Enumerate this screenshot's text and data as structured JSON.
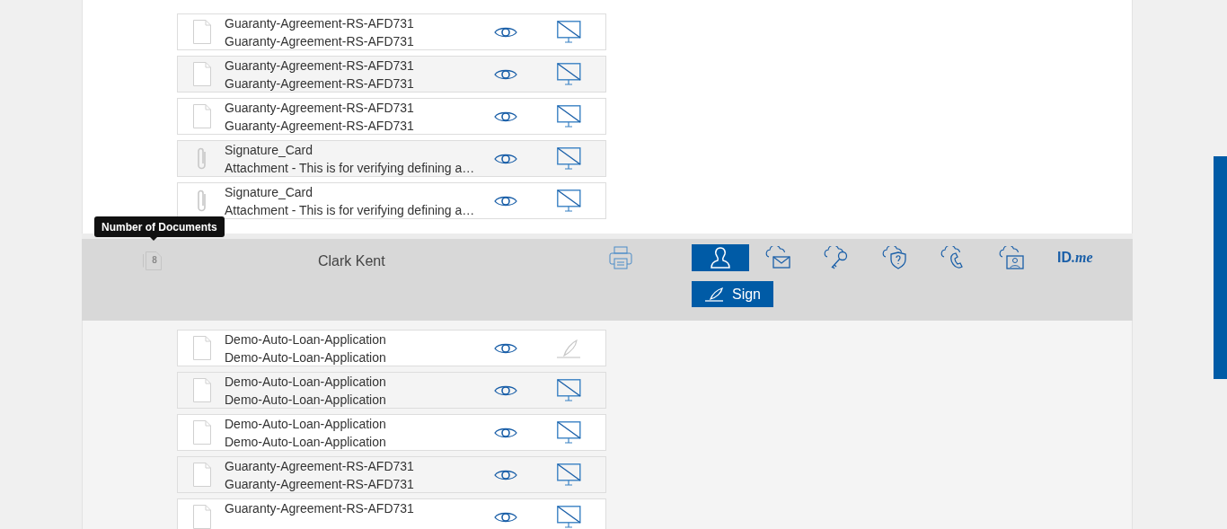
{
  "top_documents": [
    {
      "kind": "document",
      "title": "Guaranty-Agreement-RS-AFD731",
      "subtitle": "Guaranty-Agreement-RS-AFD731",
      "action": {
        "kind": "monitor"
      }
    },
    {
      "kind": "document",
      "title": "Guaranty-Agreement-RS-AFD731",
      "subtitle": "Guaranty-Agreement-RS-AFD731",
      "action": {
        "kind": "monitor"
      }
    },
    {
      "kind": "document",
      "title": "Guaranty-Agreement-RS-AFD731",
      "subtitle": "Guaranty-Agreement-RS-AFD731",
      "action": {
        "kind": "monitor"
      }
    },
    {
      "kind": "attachment",
      "title": "Signature_Card",
      "subtitle": "Attachment - This is for verifying defining a…",
      "action": {
        "kind": "monitor"
      }
    },
    {
      "kind": "attachment",
      "title": "Signature_Card",
      "subtitle": "Attachment - This is for verifying defining a…",
      "action": {
        "kind": "monitor"
      }
    }
  ],
  "tooltip": "Number of Documents",
  "signer": {
    "doc_count": "8",
    "name": "Clark Kent",
    "idme": {
      "bold": "ID",
      "italic": ".me"
    },
    "sign_button": "Sign"
  },
  "documents": [
    {
      "kind": "document",
      "title": "Demo-Auto-Loan-Application",
      "subtitle": "Demo-Auto-Loan-Application",
      "action": {
        "kind": "sign"
      }
    },
    {
      "kind": "document",
      "title": "Demo-Auto-Loan-Application",
      "subtitle": "Demo-Auto-Loan-Application",
      "action": {
        "kind": "monitor"
      }
    },
    {
      "kind": "document",
      "title": "Demo-Auto-Loan-Application",
      "subtitle": "Demo-Auto-Loan-Application",
      "action": {
        "kind": "monitor"
      }
    },
    {
      "kind": "document",
      "title": "Guaranty-Agreement-RS-AFD731",
      "subtitle": "Guaranty-Agreement-RS-AFD731",
      "action": {
        "kind": "monitor"
      }
    },
    {
      "kind": "document",
      "title": "Guaranty-Agreement-RS-AFD731",
      "action": {
        "kind": "monitor"
      }
    }
  ]
}
